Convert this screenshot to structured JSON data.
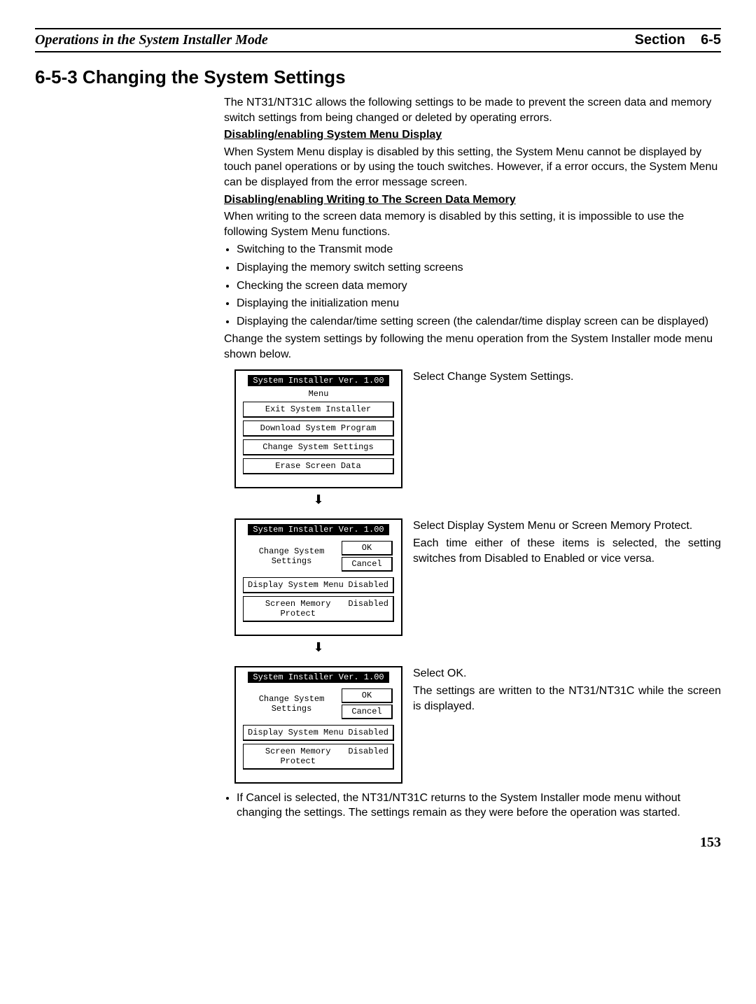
{
  "header": {
    "left": "Operations in the System Installer Mode",
    "right_label": "Section",
    "right_num": "6-5"
  },
  "title": "6-5-3  Changing the System Settings",
  "intro": "The NT31/NT31C allows the following settings to be made to prevent the screen data and memory switch settings from being changed or deleted by operating errors.",
  "sub1_heading": "Disabling/enabling System Menu Display",
  "sub1_body": "When System Menu display is disabled by this setting, the System Menu cannot be displayed by touch panel operations or by using the touch switches. However, if a error occurs, the System Menu can be displayed from the error message screen.",
  "sub2_heading": "Disabling/enabling Writing to The Screen Data Memory",
  "sub2_body": "When writing to the screen data memory is disabled by this setting, it is impossible to use the following System Menu functions.",
  "bullets": [
    "Switching to the Transmit mode",
    "Displaying the memory switch setting screens",
    "Checking the screen data memory",
    "Displaying the initialization menu",
    "Displaying the calendar/time setting screen (the calendar/time display screen can be displayed)"
  ],
  "change_intro": "Change the system settings by following the menu operation from the System Installer mode menu shown below.",
  "screen1": {
    "title": "System Installer  Ver. 1.00",
    "menu_label": "Menu",
    "items": [
      "Exit System Installer",
      "Download System Program",
      "Change System Settings",
      "Erase Screen Data"
    ],
    "caption": "Select Change System Settings."
  },
  "screen2": {
    "title": "System Installer  Ver. 1.00",
    "heading": "Change System Settings",
    "ok": "OK",
    "cancel": "Cancel",
    "row1_label": "Display System Menu",
    "row1_state": "Disabled",
    "row2_label": "Screen Memory Protect",
    "row2_state": "Disabled",
    "caption1": "Select Display System Menu or Screen Memory Protect.",
    "caption2": "Each time either of these items is selected, the setting switches from Disabled to Enabled or vice versa."
  },
  "screen3": {
    "title": "System Installer  Ver. 1.00",
    "heading": "Change System Settings",
    "ok": "OK",
    "cancel": "Cancel",
    "row1_label": "Display System Menu",
    "row1_state": "Disabled",
    "row2_label": "Screen Memory Protect",
    "row2_state": "Disabled",
    "caption1": "Select OK.",
    "caption2": "The settings are written to the NT31/NT31C while the screen is displayed."
  },
  "footnote": "If Cancel is selected, the NT31/NT31C returns to the System Installer mode menu without changing the settings. The settings remain as they were before the operation was started.",
  "page_number": "153"
}
